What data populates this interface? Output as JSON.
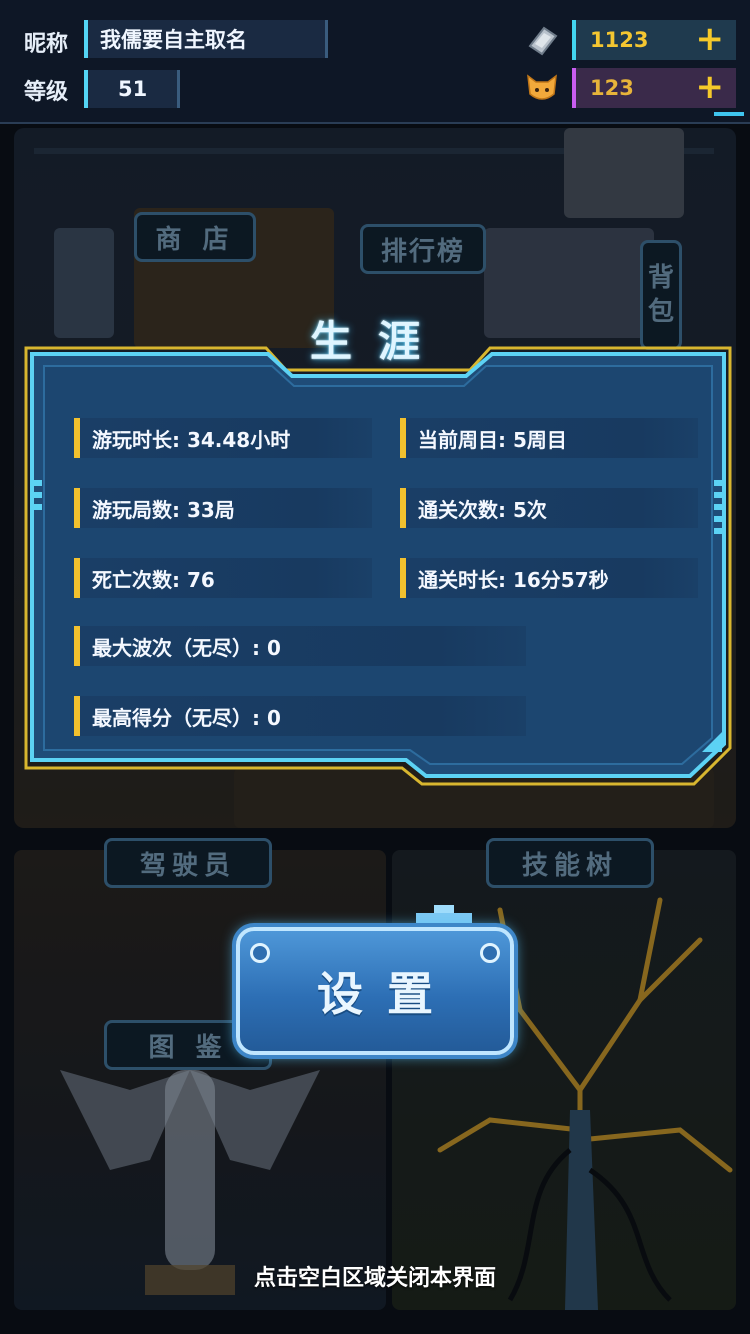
{
  "header": {
    "nickname_label": "昵称",
    "nickname_value": "我儒要自主取名",
    "level_label": "等级",
    "level_value": "51",
    "currency_primary": "1123",
    "currency_secondary": "123",
    "currency_primary_icon": "chip-icon",
    "currency_secondary_icon": "cat-head-icon",
    "plus_symbol": "+"
  },
  "scene": {
    "shop_label": "商 店",
    "leaderboard_label": "排行榜",
    "backpack_label": "背包",
    "pilot_label": "驾驶员",
    "skill_tree_label": "技能树",
    "codex_label": "图 鉴"
  },
  "modal": {
    "title": "生涯",
    "stats": [
      {
        "text": "游玩时长: 34.48小时"
      },
      {
        "text": "当前周目: 5周目"
      },
      {
        "text": "游玩局数: 33局"
      },
      {
        "text": "通关次数: 5次"
      },
      {
        "text": "死亡次数: 76"
      },
      {
        "text": "通关时长: 16分57秒"
      },
      {
        "text": "最大波次（无尽）: 0"
      },
      {
        "text": "最高得分（无尽）: 0"
      }
    ]
  },
  "settings_button": "设置",
  "close_hint": "点击空白区域关闭本界面",
  "colors": {
    "accent_cyan": "#3fc5ee",
    "accent_gold": "#f2c12e",
    "panel_blue": "#1d4a76"
  }
}
